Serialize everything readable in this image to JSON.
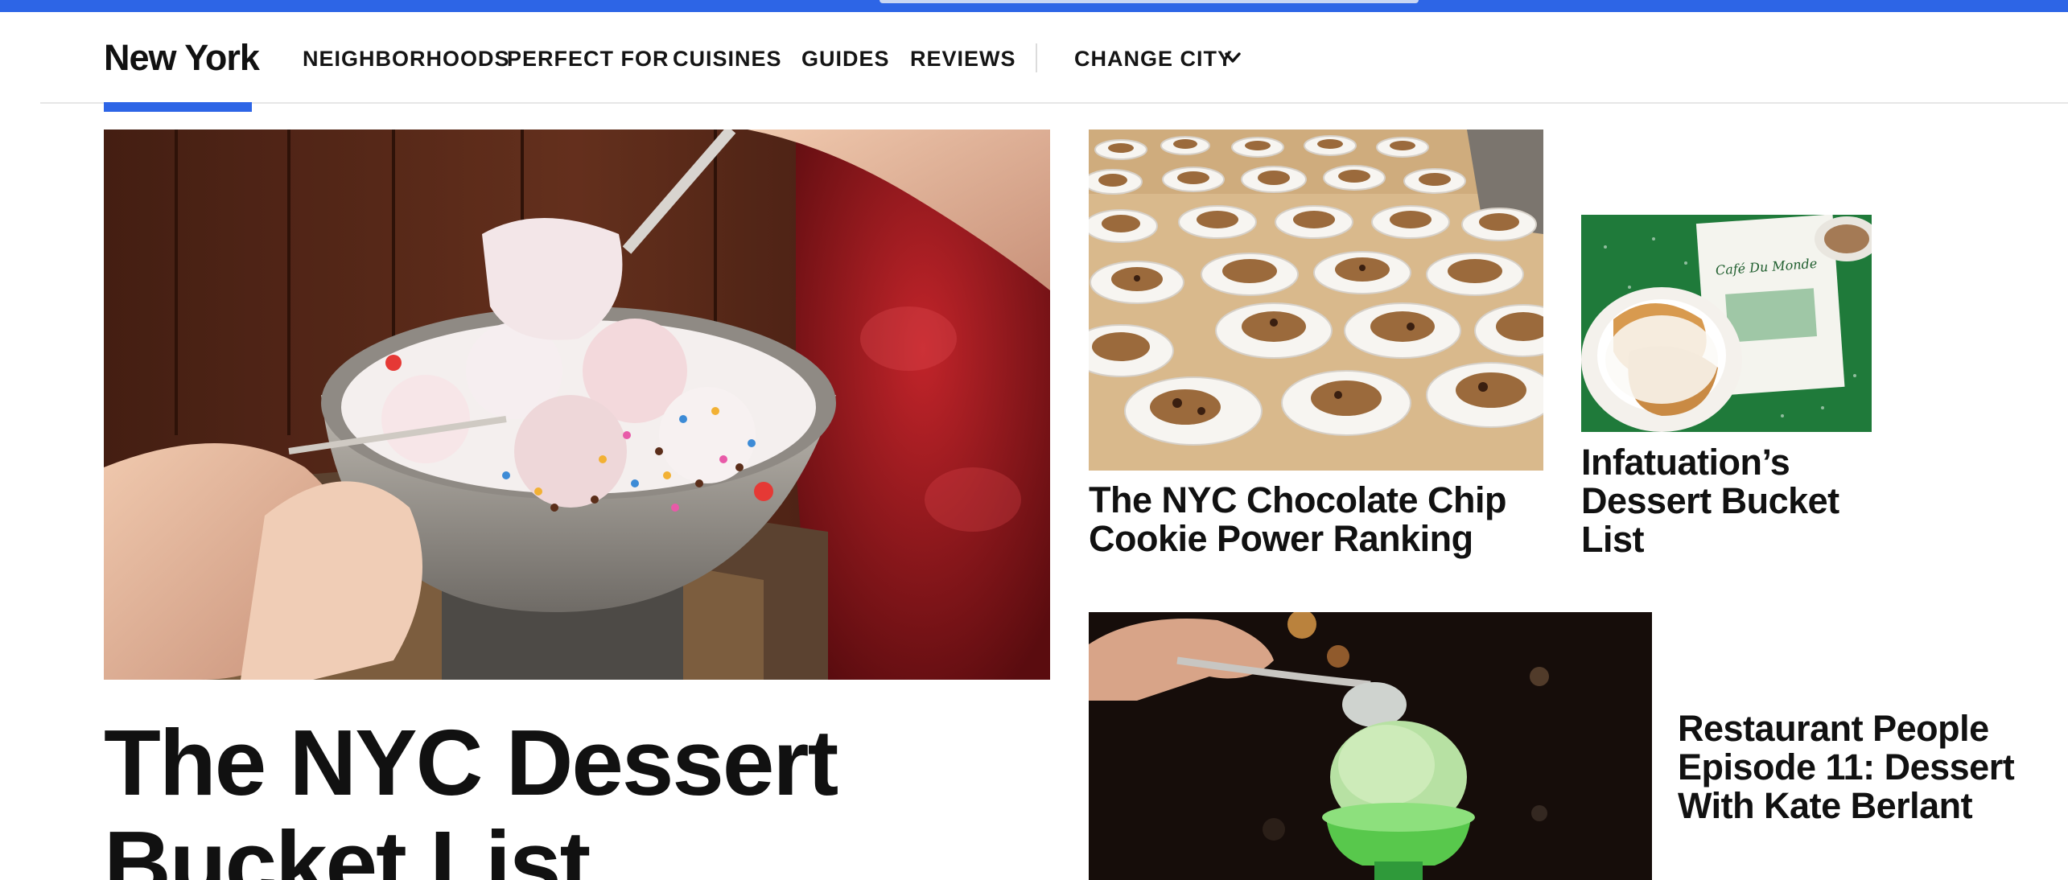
{
  "header": {
    "city": "New York",
    "nav": [
      {
        "label": "NEIGHBORHOODS"
      },
      {
        "label": "PERFECT FOR"
      },
      {
        "label": "CUISINES"
      },
      {
        "label": "GUIDES"
      },
      {
        "label": "REVIEWS"
      }
    ],
    "change_city": "CHANGE CITY"
  },
  "hero": {
    "title": "The NYC Dessert Bucket List"
  },
  "cards": [
    {
      "title": "The NYC Chocolate Chip Cookie Power Ranking"
    },
    {
      "title": "Infatuation’s Dessert Bucket List"
    },
    {
      "title": "Restaurant People Episode 11: Dessert With Kate Berlant"
    }
  ],
  "colors": {
    "accent": "#2d65e6",
    "text": "#111111"
  }
}
